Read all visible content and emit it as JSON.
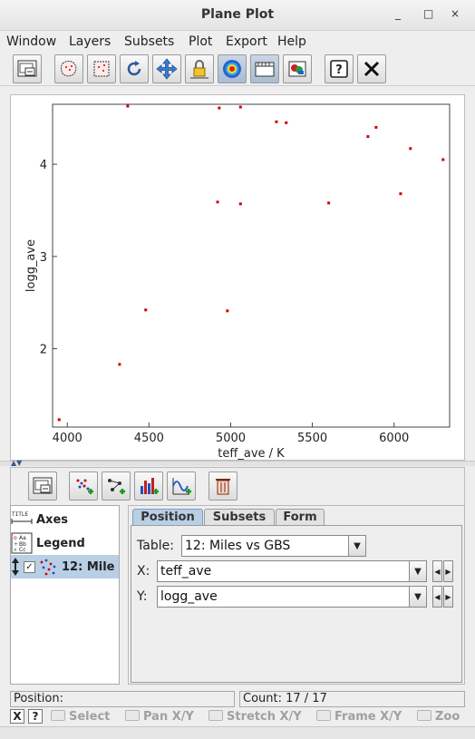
{
  "window": {
    "title": "Plane Plot",
    "controls": [
      "_",
      "□",
      "×"
    ]
  },
  "menu": [
    "Window",
    "Layers",
    "Subsets",
    "Plot",
    "Export",
    "Help"
  ],
  "toolbar_icons": [
    "axes-frame-icon",
    "blob-subset-icon",
    "region-subset-icon",
    "replot-icon",
    "pan-cross-icon",
    "lock-aspect-icon",
    "density-map-icon",
    "axis-grid-icon",
    "layer-table-icon",
    "help-icon",
    "close-icon"
  ],
  "plot": {
    "xlabel": "teff_ave / K",
    "ylabel": "logg_ave",
    "xticks": [
      "4000",
      "4500",
      "5000",
      "5500",
      "6000"
    ],
    "yticks": [
      "2",
      "3",
      "4"
    ],
    "point_color": "#cc0000"
  },
  "chart_data": {
    "type": "scatter",
    "xlabel": "teff_ave / K",
    "ylabel": "logg_ave",
    "xlim": [
      3910,
      6340
    ],
    "ylim": [
      1.15,
      4.65
    ],
    "grid": false,
    "x": [
      3950,
      4320,
      4370,
      4480,
      4920,
      4930,
      4980,
      5060,
      5060,
      5280,
      5340,
      5600,
      5840,
      5890,
      6040,
      6100,
      6300
    ],
    "y": [
      1.23,
      1.83,
      4.63,
      2.42,
      3.59,
      4.61,
      2.41,
      4.62,
      3.57,
      4.46,
      4.45,
      3.58,
      4.3,
      4.4,
      3.68,
      4.17,
      4.05
    ]
  },
  "control_toolbar_icons": [
    "axes-frame-icon",
    "add-position-layer-icon",
    "add-pair-layer-icon",
    "add-histogram-layer-icon",
    "add-function-layer-icon",
    "delete-layer-icon"
  ],
  "layers": {
    "items": [
      {
        "label": "Axes",
        "icon": "title-axes-icon"
      },
      {
        "label": "Legend",
        "icon": "legend-icon"
      },
      {
        "label": "12: Mile",
        "icon": "scatter-layer-icon"
      }
    ]
  },
  "tabs": [
    "Position",
    "Subsets",
    "Form"
  ],
  "form": {
    "table_label": "Table:",
    "table_value": "12: Miles vs GBS",
    "x_label": "X:",
    "x_value": "teff_ave",
    "y_label": "Y:",
    "y_value": "logg_ave"
  },
  "status": {
    "position_label": "Position:",
    "count_text": "Count: 17 / 17"
  },
  "modes": [
    {
      "label": "Select",
      "icon": "select-mode-icon"
    },
    {
      "label": "Pan X/Y",
      "icon": "pan-mode-icon"
    },
    {
      "label": "Stretch X/Y",
      "icon": "stretch-mode-icon"
    },
    {
      "label": "Frame X/Y",
      "icon": "frame-mode-icon"
    },
    {
      "label": "Zoo",
      "icon": "zoom-mode-icon"
    }
  ],
  "mode_toggles": [
    "X",
    "?"
  ]
}
